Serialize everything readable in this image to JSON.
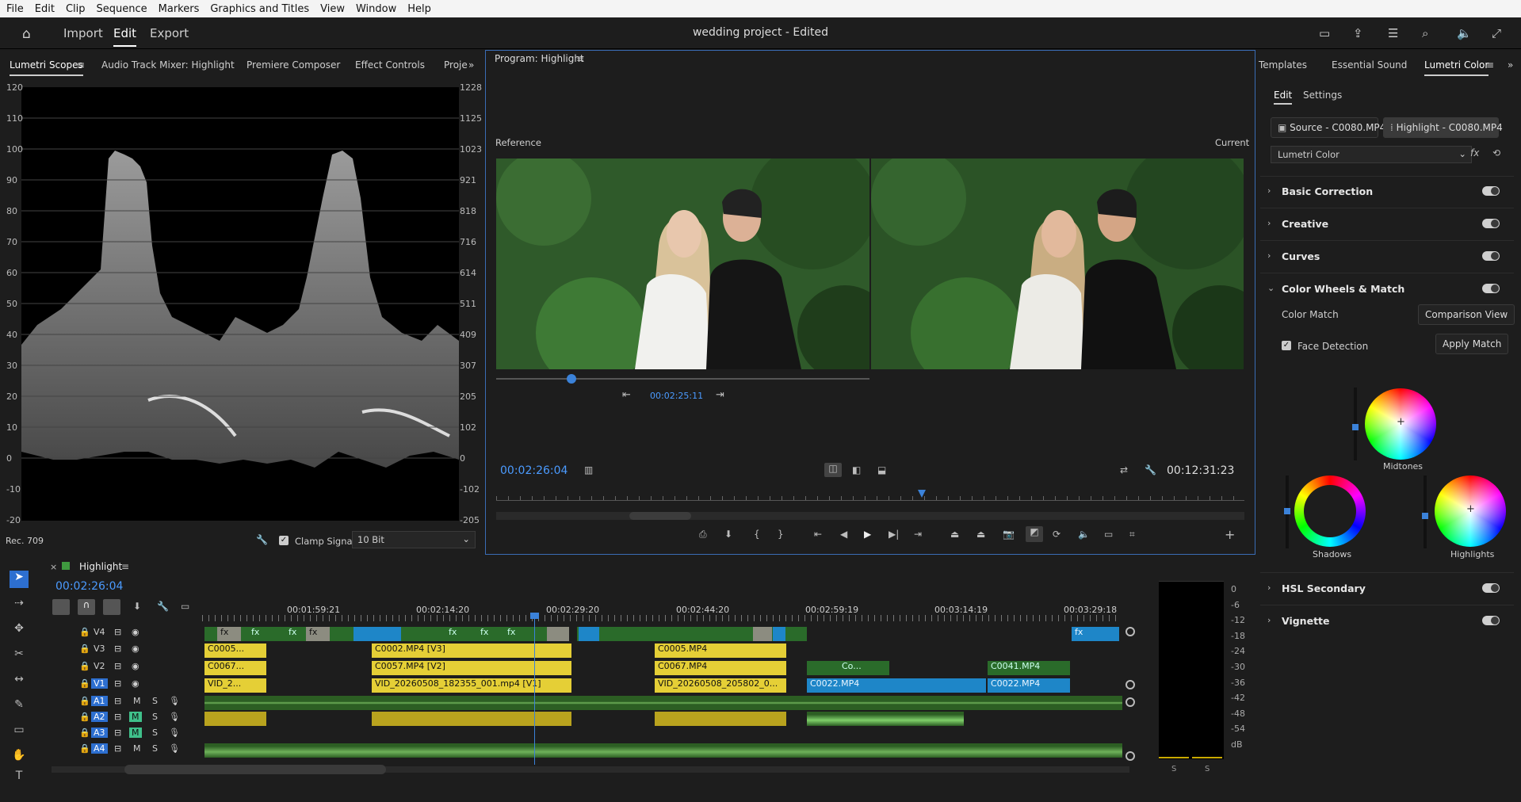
{
  "menu": [
    "File",
    "Edit",
    "Clip",
    "Sequence",
    "Markers",
    "Graphics and Titles",
    "View",
    "Window",
    "Help"
  ],
  "app": {
    "title": "wedding project - Edited",
    "nav_import": "Import",
    "nav_edit": "Edit",
    "nav_export": "Export"
  },
  "scopes": {
    "tabs": [
      "Lumetri Scopes",
      "Audio Track Mixer: Highlight",
      "Premiere Composer",
      "Effect Controls",
      "Proje"
    ],
    "left_scale": [
      "120",
      "110",
      "100",
      "90",
      "80",
      "70",
      "60",
      "50",
      "40",
      "30",
      "20",
      "10",
      "0",
      "-10",
      "-20"
    ],
    "right_scale": [
      "1228",
      "1125",
      "1023",
      "921",
      "818",
      "716",
      "614",
      "511",
      "409",
      "307",
      "205",
      "102",
      "0",
      "-102",
      "-205"
    ],
    "footer_left": "Rec. 709",
    "clamp_label": "Clamp Signal",
    "bit_depth": "10 Bit"
  },
  "program": {
    "title": "Program: Highlight",
    "reference_label": "Reference",
    "current_label": "Current",
    "ref_timecode": "00:02:25:11",
    "timecode": "00:02:26:04",
    "duration": "00:12:31:23"
  },
  "lumetri": {
    "tabs": [
      "Templates",
      "Essential Sound",
      "Lumetri Color"
    ],
    "subtabs": [
      "Edit",
      "Settings"
    ],
    "source_clip": "Source - C0080.MP4",
    "highlight_clip": "Highlight - C0080.MP4",
    "effect_select": "Lumetri Color",
    "sections": [
      "Basic Correction",
      "Creative",
      "Curves",
      "Color Wheels & Match",
      "HSL Secondary",
      "Vignette"
    ],
    "color_match_label": "Color Match",
    "comparison_view": "Comparison View",
    "face_detection": "Face Detection",
    "apply_match": "Apply Match",
    "wheels": [
      "Midtones",
      "Shadows",
      "Highlights"
    ]
  },
  "timeline": {
    "sequence": "Highlight",
    "timecode": "00:02:26:04",
    "ruler": [
      "00:01:59:21",
      "00:02:14:20",
      "00:02:29:20",
      "00:02:44:20",
      "00:02:59:19",
      "00:03:14:19",
      "00:03:29:18"
    ],
    "tracks": [
      "V4",
      "V3",
      "V2",
      "V1",
      "A1",
      "A2",
      "A3",
      "A4"
    ],
    "v3_clips": [
      "C0005...",
      "C0002.MP4 [V3]",
      "C0005.MP4"
    ],
    "v2_clips": [
      "C0067...",
      "C0057.MP4 [V2]",
      "C0067.MP4",
      "Co...",
      "C0041.MP4"
    ],
    "v1_clips": [
      "VID_2...",
      "VID_20260508_182355_001.mp4 [V1]",
      "VID_20260508_205802_0...",
      "C0022.MP4",
      "C0022.MP4"
    ],
    "fx": "fx",
    "m": "M",
    "s": "S"
  },
  "meters": {
    "scale": [
      "0",
      "-6",
      "-12",
      "-18",
      "-24",
      "-30",
      "-36",
      "-42",
      "-48",
      "-54",
      "dB"
    ],
    "solo": "S"
  }
}
